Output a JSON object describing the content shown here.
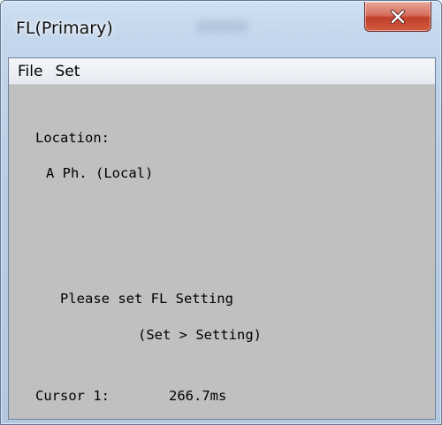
{
  "window": {
    "title": "FL(Primary)",
    "close_icon": "close-x-icon",
    "close_color": "#c7402c"
  },
  "menubar": {
    "items": [
      {
        "label": "File"
      },
      {
        "label": "Set"
      }
    ]
  },
  "content": {
    "background": "#c0c0c0",
    "location_label": "Location:",
    "location_value": "A Ph. (Local)",
    "message_line1": "Please set FL Setting",
    "message_line2": "(Set > Setting)",
    "cursor_label": "Cursor 1:",
    "cursor_value": "266.7ms"
  }
}
